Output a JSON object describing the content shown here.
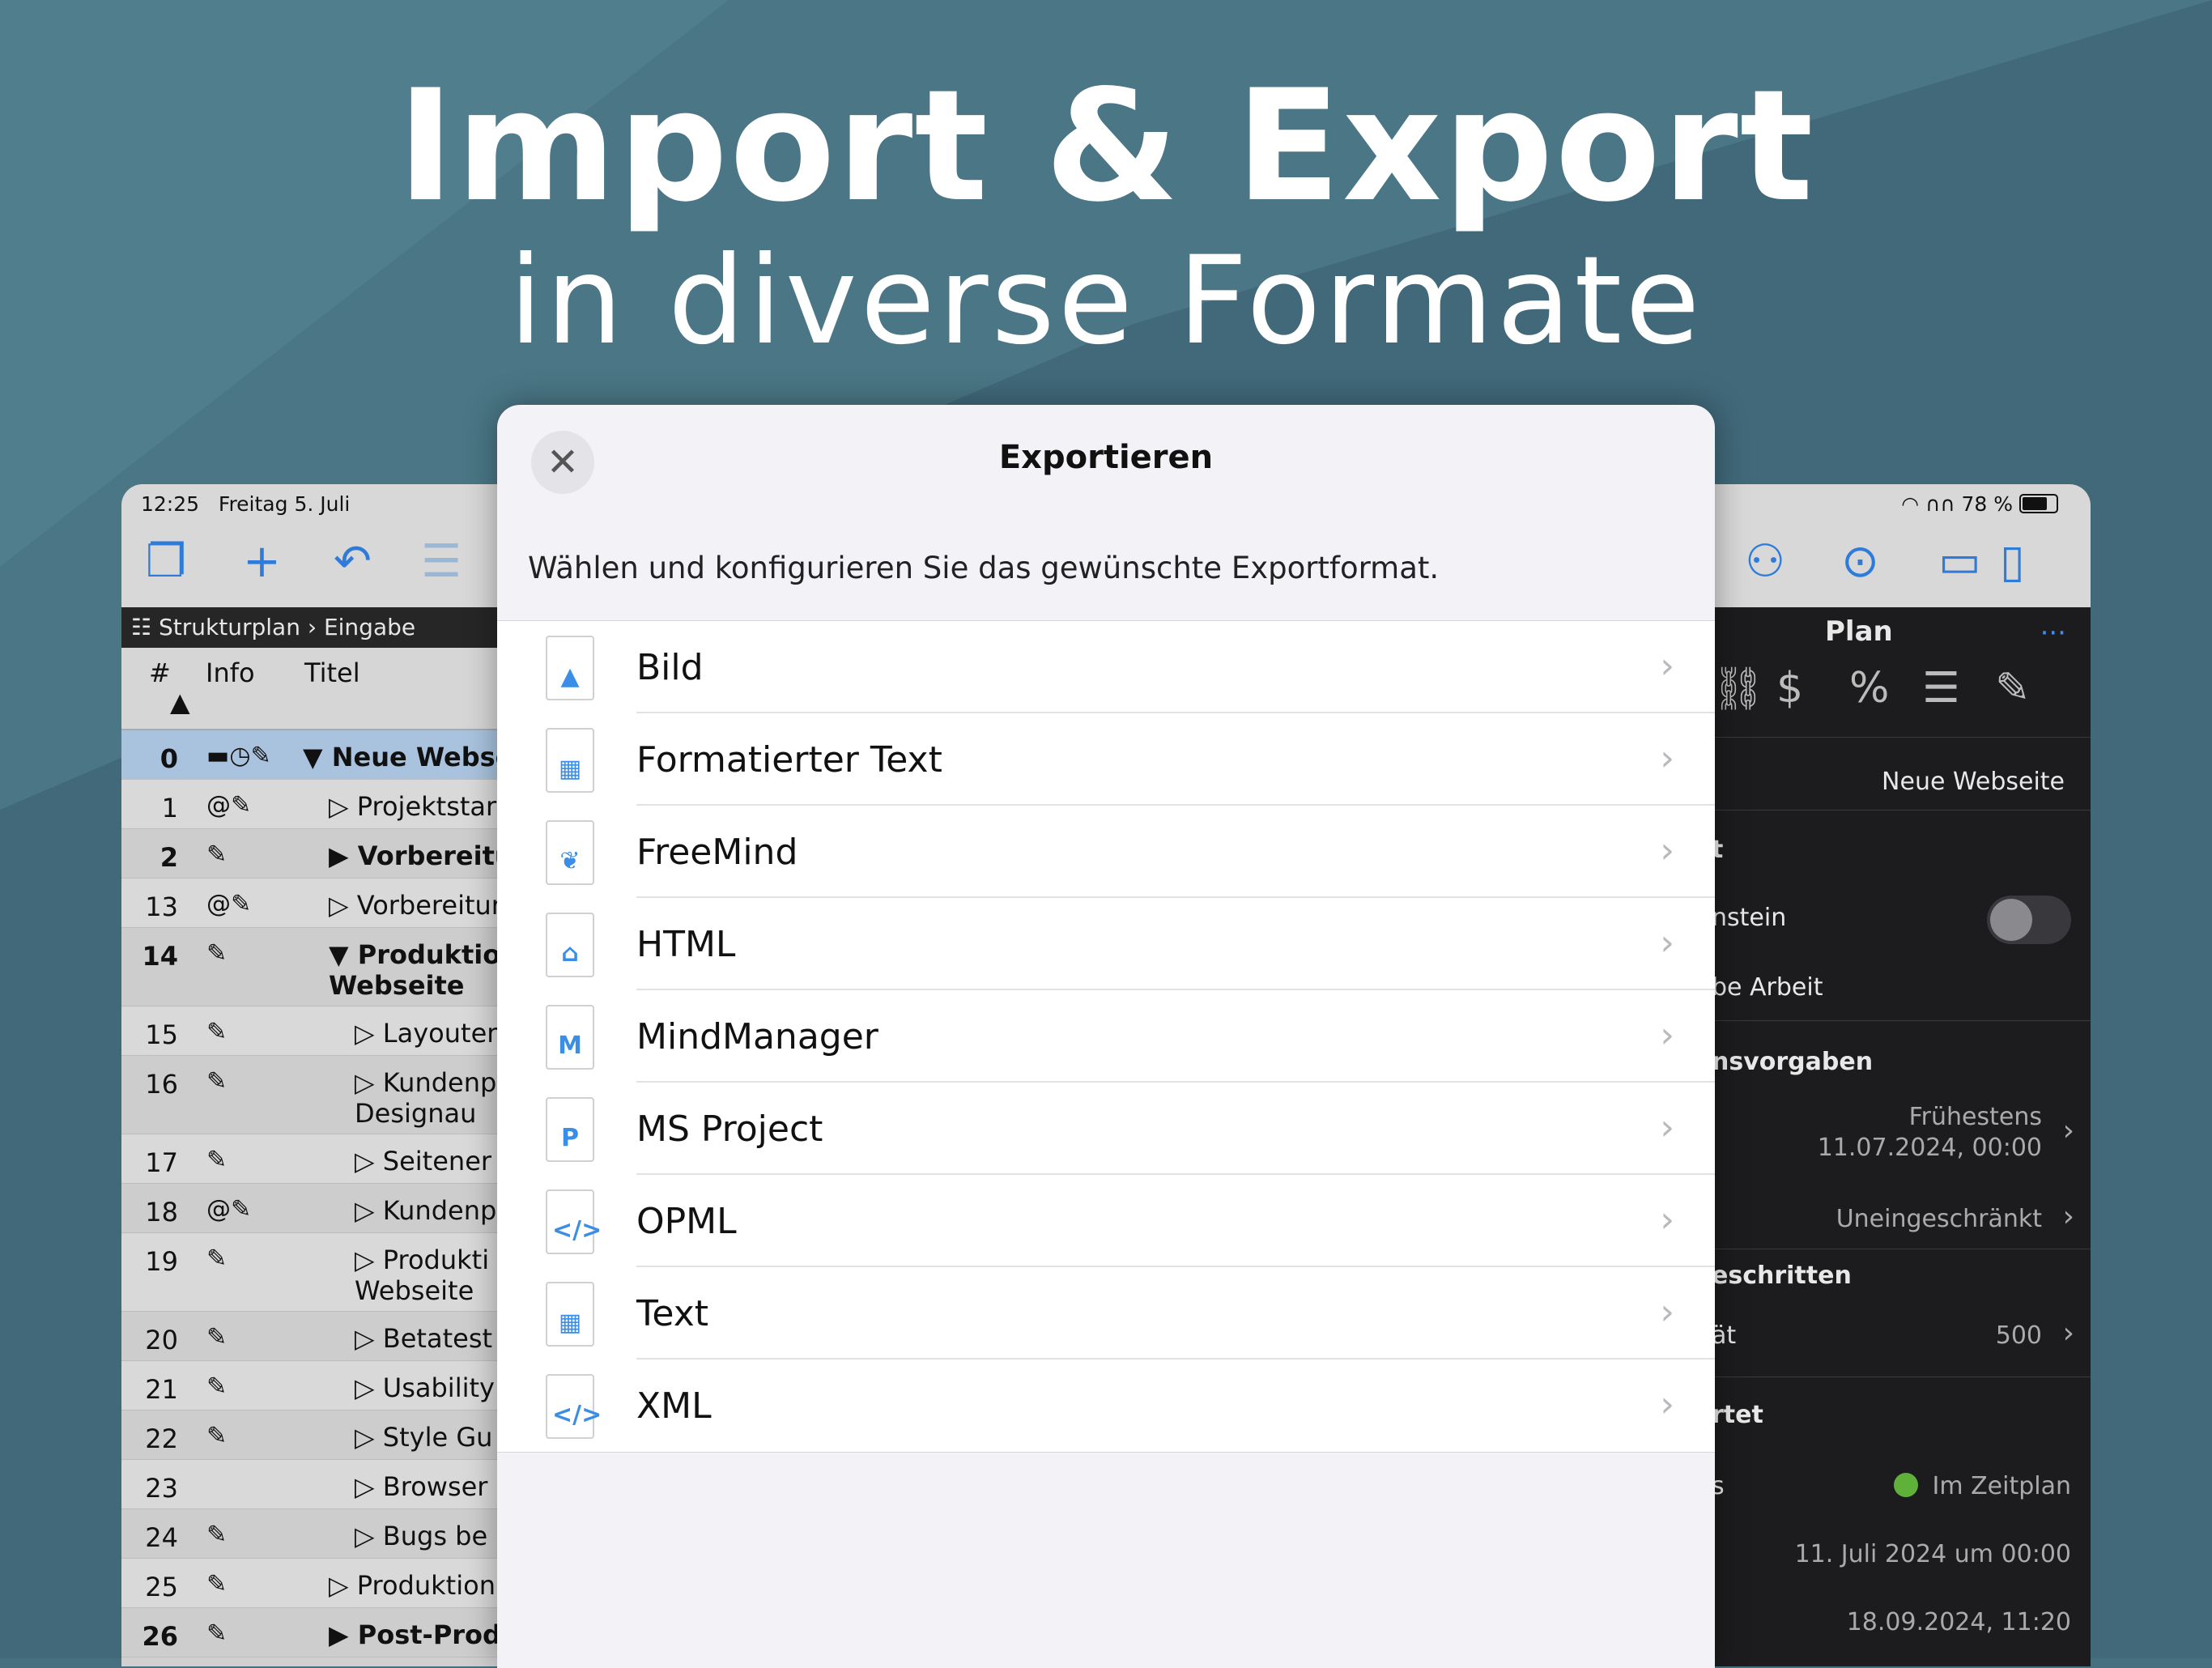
{
  "headline": {
    "title": "Import & Export",
    "subtitle": "in diverse Formate"
  },
  "statusbar": {
    "time": "12:25",
    "date": "Freitag 5. Juli",
    "battery": "78 %"
  },
  "breadcrumb": {
    "root": "Strukturplan",
    "current": "Eingabe"
  },
  "table": {
    "columns": [
      "#",
      "Info",
      "Titel"
    ],
    "rows": [
      {
        "num": "0",
        "info": "▬◷✎",
        "title": "▼ Neue Webse",
        "bold": true,
        "selected": true,
        "indent": 0,
        "double": false
      },
      {
        "num": "1",
        "info": "@✎",
        "title": "▷ Projektstar",
        "bold": false,
        "selected": false,
        "indent": 1,
        "double": false
      },
      {
        "num": "2",
        "info": "✎",
        "title": "▶ Vorbereitu",
        "bold": true,
        "selected": false,
        "indent": 1,
        "double": false
      },
      {
        "num": "13",
        "info": "@✎",
        "title": "▷ Vorbereitur",
        "bold": false,
        "selected": false,
        "indent": 1,
        "double": false
      },
      {
        "num": "14",
        "info": "✎",
        "title": "▼ Produktion\nWebseite",
        "bold": true,
        "selected": false,
        "indent": 1,
        "double": true
      },
      {
        "num": "15",
        "info": "✎",
        "title": "▷ Layouter",
        "bold": false,
        "selected": false,
        "indent": 2,
        "double": false
      },
      {
        "num": "16",
        "info": "✎",
        "title": "▷ Kundenp\nDesignau",
        "bold": false,
        "selected": false,
        "indent": 2,
        "double": true
      },
      {
        "num": "17",
        "info": "✎",
        "title": "▷ Seitener",
        "bold": false,
        "selected": false,
        "indent": 2,
        "double": false
      },
      {
        "num": "18",
        "info": "@✎",
        "title": "▷ Kundenp",
        "bold": false,
        "selected": false,
        "indent": 2,
        "double": false
      },
      {
        "num": "19",
        "info": "✎",
        "title": "▷ Produkti\nWebseite",
        "bold": false,
        "selected": false,
        "indent": 2,
        "double": true
      },
      {
        "num": "20",
        "info": "✎",
        "title": "▷ Betatest",
        "bold": false,
        "selected": false,
        "indent": 2,
        "double": false
      },
      {
        "num": "21",
        "info": "✎",
        "title": "▷ Usability",
        "bold": false,
        "selected": false,
        "indent": 2,
        "double": false
      },
      {
        "num": "22",
        "info": "✎",
        "title": "▷ Style Gu",
        "bold": false,
        "selected": false,
        "indent": 2,
        "double": false
      },
      {
        "num": "23",
        "info": "",
        "title": "▷ Browser",
        "bold": false,
        "selected": false,
        "indent": 2,
        "double": false
      },
      {
        "num": "24",
        "info": "✎",
        "title": "▷ Bugs be",
        "bold": false,
        "selected": false,
        "indent": 2,
        "double": false
      },
      {
        "num": "25",
        "info": "✎",
        "title": "▷ Produktion",
        "bold": false,
        "selected": false,
        "indent": 1,
        "double": false
      },
      {
        "num": "26",
        "info": "✎",
        "title": "▶ Post-Prod",
        "bold": true,
        "selected": false,
        "indent": 1,
        "double": false
      }
    ]
  },
  "inspector": {
    "title": "Plan",
    "more": "···",
    "name": "Neue Webseite",
    "sec1_head": "t",
    "milestone_label": "nstein",
    "work_label": "be Arbeit",
    "sec2_head": "nsvorgaben",
    "earliest_label": "Frühestens",
    "earliest_value": "11.07.2024, 00:00",
    "limit_value": "Uneingeschränkt",
    "sec3_head": "eschritten",
    "capacity_label": "ät",
    "capacity_value": "500",
    "sec4_head": "rtet",
    "status_label": "s",
    "status_value": "Im Zeitplan",
    "start_value": "11. Juli 2024 um 00:00",
    "end_value": "18.09.2024, 11:20"
  },
  "modal": {
    "title": "Exportieren",
    "close_glyph": "✕",
    "description": "Wählen und konfigurieren Sie das gewünschte Exportformat.",
    "chevron": "›",
    "items": [
      {
        "label": "Bild",
        "icon": "image-icon",
        "glyph": "▲",
        "color": "#3a8ee6"
      },
      {
        "label": "Formatierter Text",
        "icon": "formatted-text-icon",
        "glyph": "▦",
        "color": "#3a8ee6"
      },
      {
        "label": "FreeMind",
        "icon": "butterfly-icon",
        "glyph": "❦",
        "color": "#3a8ee6"
      },
      {
        "label": "HTML",
        "icon": "house-icon",
        "glyph": "⌂",
        "color": "#3a8ee6"
      },
      {
        "label": "MindManager",
        "icon": "mindmanager-icon",
        "glyph": "M",
        "color": "#3a8ee6"
      },
      {
        "label": "MS Project",
        "icon": "ms-project-icon",
        "glyph": "P",
        "color": "#3a8ee6"
      },
      {
        "label": "OPML",
        "icon": "code-icon",
        "glyph": "</>",
        "color": "#3a8ee6"
      },
      {
        "label": "Text",
        "icon": "table-icon",
        "glyph": "▦",
        "color": "#3a8ee6"
      },
      {
        "label": "XML",
        "icon": "code-icon",
        "glyph": "</>",
        "color": "#3a8ee6"
      }
    ]
  },
  "colors": {
    "accent": "#2f7bd9",
    "background": "#46707f",
    "status_green": "#5fb13a"
  }
}
